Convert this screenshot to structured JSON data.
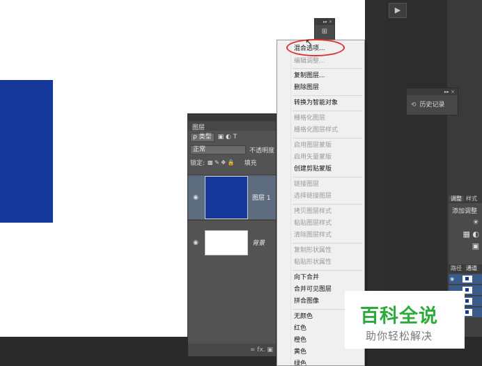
{
  "play_button": "▶",
  "mini_panel": {
    "controls": "▸▸ ×",
    "icon": "⊞"
  },
  "history_panel": {
    "controls": "▸▸ ×",
    "icon": "⟲",
    "label": "历史记录"
  },
  "adjustments_panel": {
    "tabs": [
      "调整",
      "样式"
    ],
    "title": "添加调整",
    "icon1": "☀",
    "icon2": "▦ ◐",
    "icon3": "▣"
  },
  "paths_panel": {
    "tabs": [
      "路径",
      "通道"
    ],
    "eye": "◉"
  },
  "layers_panel": {
    "tab": "图层",
    "filter_kind": "ρ 类型",
    "filter_icons": "▣ ◐ T",
    "blend_mode": "正常",
    "opacity_label": "不透明度",
    "lock_label": "锁定:",
    "lock_icons": "▩ ✎ ✥ 🔒",
    "fill_label": "填充",
    "layers": [
      {
        "name": "图层 1",
        "eye": "◉"
      },
      {
        "name": "背景",
        "eye": "◉"
      }
    ],
    "footer_icons": "∞  fx. ▣"
  },
  "context_menu": {
    "items": [
      {
        "label": "混合选项...",
        "disabled": false
      },
      {
        "label": "编辑调整...",
        "disabled": true
      },
      {
        "label": "复制图层...",
        "disabled": false
      },
      {
        "label": "删除图层",
        "disabled": false
      },
      {
        "label": "转换为智能对象",
        "disabled": false
      },
      {
        "label": "栅格化图层",
        "disabled": true
      },
      {
        "label": "栅格化图层样式",
        "disabled": true
      },
      {
        "label": "启用图层蒙版",
        "disabled": true
      },
      {
        "label": "启用矢量蒙版",
        "disabled": true
      },
      {
        "label": "创建剪贴蒙版",
        "disabled": false
      },
      {
        "label": "链接图层",
        "disabled": true
      },
      {
        "label": "选择链接图层",
        "disabled": true
      },
      {
        "label": "拷贝图层样式",
        "disabled": true
      },
      {
        "label": "粘贴图层样式",
        "disabled": true
      },
      {
        "label": "清除图层样式",
        "disabled": true
      },
      {
        "label": "复制形状属性",
        "disabled": true
      },
      {
        "label": "粘贴形状属性",
        "disabled": true
      },
      {
        "label": "向下合并",
        "disabled": false
      },
      {
        "label": "合并可见图层",
        "disabled": false
      },
      {
        "label": "拼合图像",
        "disabled": false
      },
      {
        "label": "无颜色",
        "disabled": false
      },
      {
        "label": "红色",
        "disabled": false
      },
      {
        "label": "橙色",
        "disabled": false
      },
      {
        "label": "黄色",
        "disabled": false
      },
      {
        "label": "绿色",
        "disabled": false
      }
    ]
  },
  "watermark": {
    "main": "百科全说",
    "sub": "助你轻松解决"
  },
  "colors": {
    "canvas_blue": "#15389a",
    "annotation_red": "#e03030",
    "watermark_green": "#2dab3a"
  }
}
